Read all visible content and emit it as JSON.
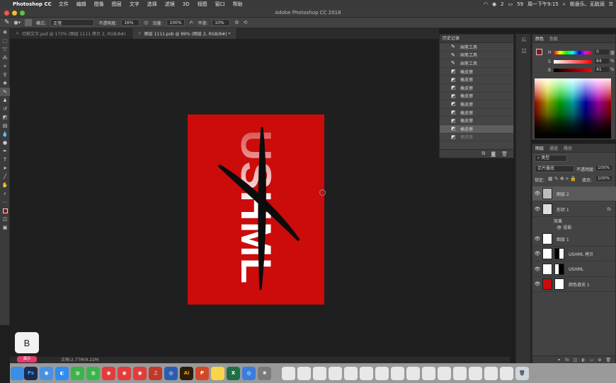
{
  "menubar": {
    "app_name": "Photoshop CC",
    "items": [
      "文件",
      "编辑",
      "图像",
      "图层",
      "文字",
      "选择",
      "滤镜",
      "3D",
      "视图",
      "窗口",
      "帮助"
    ],
    "clock": "周一下午9:15",
    "battery": "59",
    "badge_count": "2",
    "user": "桃香乐、无敌润"
  },
  "window": {
    "title": "Adobe Photoshop CC 2018"
  },
  "options": {
    "mode_label": "模式:",
    "mode_value": "正常",
    "opacity_label": "不透明度:",
    "opacity_value": "16%",
    "flow_label": "流量:",
    "flow_value": "100%",
    "smooth_label": "平滑:",
    "smooth_value": "10%"
  },
  "tabs": [
    {
      "label": "切割文字.psd @ 173% (图层 1111 拷贝 2, RGB/8#)",
      "active": false
    },
    {
      "label": "图层 1111.psb @ 89% (图层 2, RGB/8#) *",
      "active": true
    }
  ],
  "artwork": {
    "text": "USHML"
  },
  "status": {
    "doc_info": "文档:2.77M/9.22M"
  },
  "history": {
    "title": "历史记录",
    "items": [
      {
        "label": "画笔工具",
        "icon": "brush-icon"
      },
      {
        "label": "画笔工具",
        "icon": "brush-icon"
      },
      {
        "label": "画笔工具",
        "icon": "brush-icon"
      },
      {
        "label": "橡皮擦",
        "icon": "eraser-icon"
      },
      {
        "label": "橡皮擦",
        "icon": "eraser-icon"
      },
      {
        "label": "橡皮擦",
        "icon": "eraser-icon"
      },
      {
        "label": "橡皮擦",
        "icon": "eraser-icon"
      },
      {
        "label": "橡皮擦",
        "icon": "eraser-icon"
      },
      {
        "label": "橡皮擦",
        "icon": "eraser-icon"
      },
      {
        "label": "橡皮擦",
        "icon": "eraser-icon"
      },
      {
        "label": "橡皮擦",
        "icon": "eraser-icon"
      },
      {
        "label": "橡皮擦",
        "icon": "eraser-icon"
      }
    ]
  },
  "color_panel": {
    "tabs": [
      "颜色",
      "色板"
    ],
    "h_label": "H",
    "h_value": "0",
    "s_label": "S",
    "s_value": "84",
    "b_label": "B",
    "b_value": "41",
    "h_unit": "度",
    "s_unit": "%",
    "b_unit": "%",
    "foreground": "#8b1414"
  },
  "layers_panel": {
    "tabs": [
      "图层",
      "通道",
      "路径"
    ],
    "kind_label": "类型",
    "blend_mode": "正片叠底",
    "opacity_label": "不透明度:",
    "opacity_value": "100%",
    "lock_label": "锁定:",
    "fill_label": "填充:",
    "fill_value": "100%",
    "layers": [
      {
        "name": "图层 2",
        "selected": true
      },
      {
        "name": "形状 1",
        "fx": "fx"
      },
      {
        "name": "效果",
        "sub": true
      },
      {
        "name": "投影",
        "sub": true
      },
      {
        "name": "图层 1"
      },
      {
        "name": "USHML 拷贝"
      },
      {
        "name": "USHML"
      },
      {
        "name": "颜色填充 1"
      }
    ]
  },
  "keycast": {
    "key": "B",
    "label": "演示"
  },
  "dock": {
    "apps": [
      "Finder",
      "Ps",
      "Chrome",
      "QQ",
      "WeChat",
      "WeChat",
      "QQ",
      "QQ",
      "QQ",
      "Music",
      "Safari",
      "Ai",
      "P",
      "Notes",
      "X",
      "Baidu",
      "Photo"
    ]
  }
}
